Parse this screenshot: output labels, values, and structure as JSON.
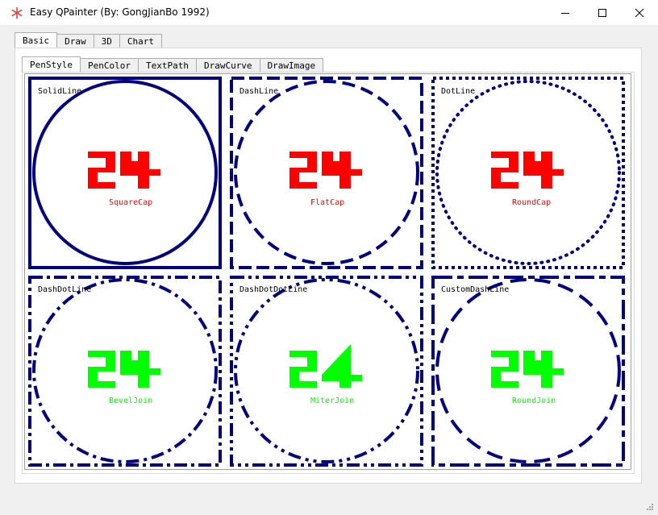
{
  "window": {
    "title": "Easy QPainter (By: GongJianBo 1992)",
    "icon": "snowflake-icon",
    "controls": [
      "minimize-icon",
      "maximize-icon",
      "close-icon"
    ]
  },
  "main_tabs": [
    {
      "label": "Basic",
      "active": true
    },
    {
      "label": "Draw",
      "active": false
    },
    {
      "label": "3D",
      "active": false
    },
    {
      "label": "Chart",
      "active": false
    }
  ],
  "sub_tabs": [
    {
      "label": "PenStyle",
      "active": true
    },
    {
      "label": "PenColor",
      "active": false
    },
    {
      "label": "TextPath",
      "active": false
    },
    {
      "label": "DrawCurve",
      "active": false
    },
    {
      "label": "DrawImage",
      "active": false
    }
  ],
  "colors": {
    "stroke": "#000080",
    "red_text": "#ff0000",
    "green_text": "#00ff00"
  },
  "cells": [
    {
      "pen_style": "SolidLine",
      "glyph": "24",
      "label": "SquareCap",
      "color": "red"
    },
    {
      "pen_style": "DashLine",
      "glyph": "24",
      "label": "FlatCap",
      "color": "red"
    },
    {
      "pen_style": "DotLine",
      "glyph": "24",
      "label": "RoundCap",
      "color": "red"
    },
    {
      "pen_style": "DashDotLine",
      "glyph": "24",
      "label": "BevelJoin",
      "color": "green"
    },
    {
      "pen_style": "DashDotDotLine",
      "glyph": "24",
      "label": "MiterJoin",
      "color": "green"
    },
    {
      "pen_style": "CustomDashLine",
      "glyph": "24",
      "label": "RoundJoin",
      "color": "green"
    }
  ]
}
